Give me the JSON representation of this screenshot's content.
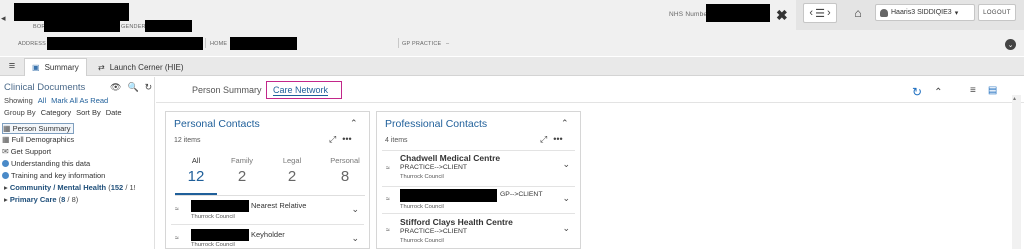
{
  "header": {
    "back_arrow": "◂",
    "labels": {
      "born": "BORN",
      "gender": "GENDER",
      "address": "ADDRESS",
      "home": "HOME",
      "gp_practice": "GP PRACTICE",
      "gp_practice_value": "–"
    },
    "nhs_label": "NHS Number",
    "close_glyph": "✖",
    "nav_glyphs": {
      "prev": "‹",
      "list": "☰",
      "next": "›"
    },
    "home_glyph": "⌂",
    "user": {
      "name": "Haaris3 SIDDIQIE3",
      "icon": "person-icon",
      "caret": "▾"
    },
    "logout_label": "LOGOUT",
    "expand_glyph": "⌄"
  },
  "tabs": {
    "menu_glyph": "≡",
    "items": [
      {
        "label": "Summary",
        "icon": "summary-icon",
        "glyph": "▣",
        "active": true
      },
      {
        "label": "Launch Cerner (HIE)",
        "icon": "swap-arrows-icon",
        "glyph": "⇄",
        "active": false
      }
    ]
  },
  "sidebar": {
    "title": "Clinical Documents",
    "tool_icons": {
      "view": "👁",
      "search": "🔍",
      "refresh": "↻"
    },
    "showing_label": "Showing",
    "showing_all": "All",
    "mark_all_read": "Mark All As Read",
    "group_by_label": "Group By",
    "group_by_value": "Category",
    "sort_by_label": "Sort By",
    "sort_by_value": "Date",
    "documents": [
      {
        "label": "Person Summary",
        "icon": "grid-icon",
        "glyph": "▦",
        "selected": true
      },
      {
        "label": "Full Demographics",
        "icon": "grid-icon",
        "glyph": "▦",
        "selected": false
      },
      {
        "label": "Get Support",
        "icon": "envelope-icon",
        "glyph": "✉",
        "selected": false
      },
      {
        "label": "Understanding this data",
        "icon": "info-icon",
        "selected": false
      },
      {
        "label": "Training and key information",
        "icon": "info-icon",
        "selected": false
      }
    ],
    "tree": [
      {
        "caret": "▸",
        "label": "Community / Mental Health",
        "count_bold": "152",
        "count_rest": " / 1!"
      },
      {
        "caret": "▸",
        "label": "Primary Care",
        "count_bold": "8",
        "count_rest": " / 8)"
      }
    ]
  },
  "main": {
    "subtabs": [
      {
        "label": "Person Summary",
        "active": false
      },
      {
        "label": "Care Network",
        "active": true
      }
    ],
    "toolbar_glyphs": {
      "refresh": "↻",
      "collapse": "⌃",
      "list_view": "≡",
      "card_view": "▤"
    },
    "scroll_up": "▴"
  },
  "personal_contacts": {
    "title": "Personal Contacts",
    "count_text": "12 items",
    "chevron": "⌃",
    "expand_glyph": "⤢",
    "more_glyph": "•••",
    "filters": [
      {
        "label": "All",
        "count": "12",
        "active": true
      },
      {
        "label": "Family",
        "count": "2",
        "active": false
      },
      {
        "label": "Legal",
        "count": "2",
        "active": false
      },
      {
        "label": "Personal",
        "count": "8",
        "active": false
      }
    ],
    "contacts": [
      {
        "relationship": "Nearest Relative",
        "org": "Thurrock Council",
        "icon": "contact-icon",
        "glyph": "≈",
        "chev": "⌄"
      },
      {
        "relationship": "Keyholder",
        "org": "Thurrock Council",
        "icon": "contact-icon",
        "glyph": "≈",
        "chev": "⌄"
      }
    ]
  },
  "professional_contacts": {
    "title": "Professional Contacts",
    "count_text": "4 items",
    "chevron": "⌃",
    "expand_glyph": "⤢",
    "more_glyph": "•••",
    "contacts": [
      {
        "name": "Chadwell Medical Centre",
        "relationship": "PRACTICE-->CLIENT",
        "org": "Thurrock Council",
        "glyph": "≈",
        "chev": "⌄"
      },
      {
        "name": "",
        "relationship": "GP-->CLIENT",
        "org": "Thurrock Council",
        "glyph": "≈",
        "chev": "⌄"
      },
      {
        "name": "Stifford Clays Health Centre",
        "relationship": "PRACTICE-->CLIENT",
        "org": "Thurrock Council",
        "glyph": "≈",
        "chev": "⌄"
      }
    ]
  }
}
